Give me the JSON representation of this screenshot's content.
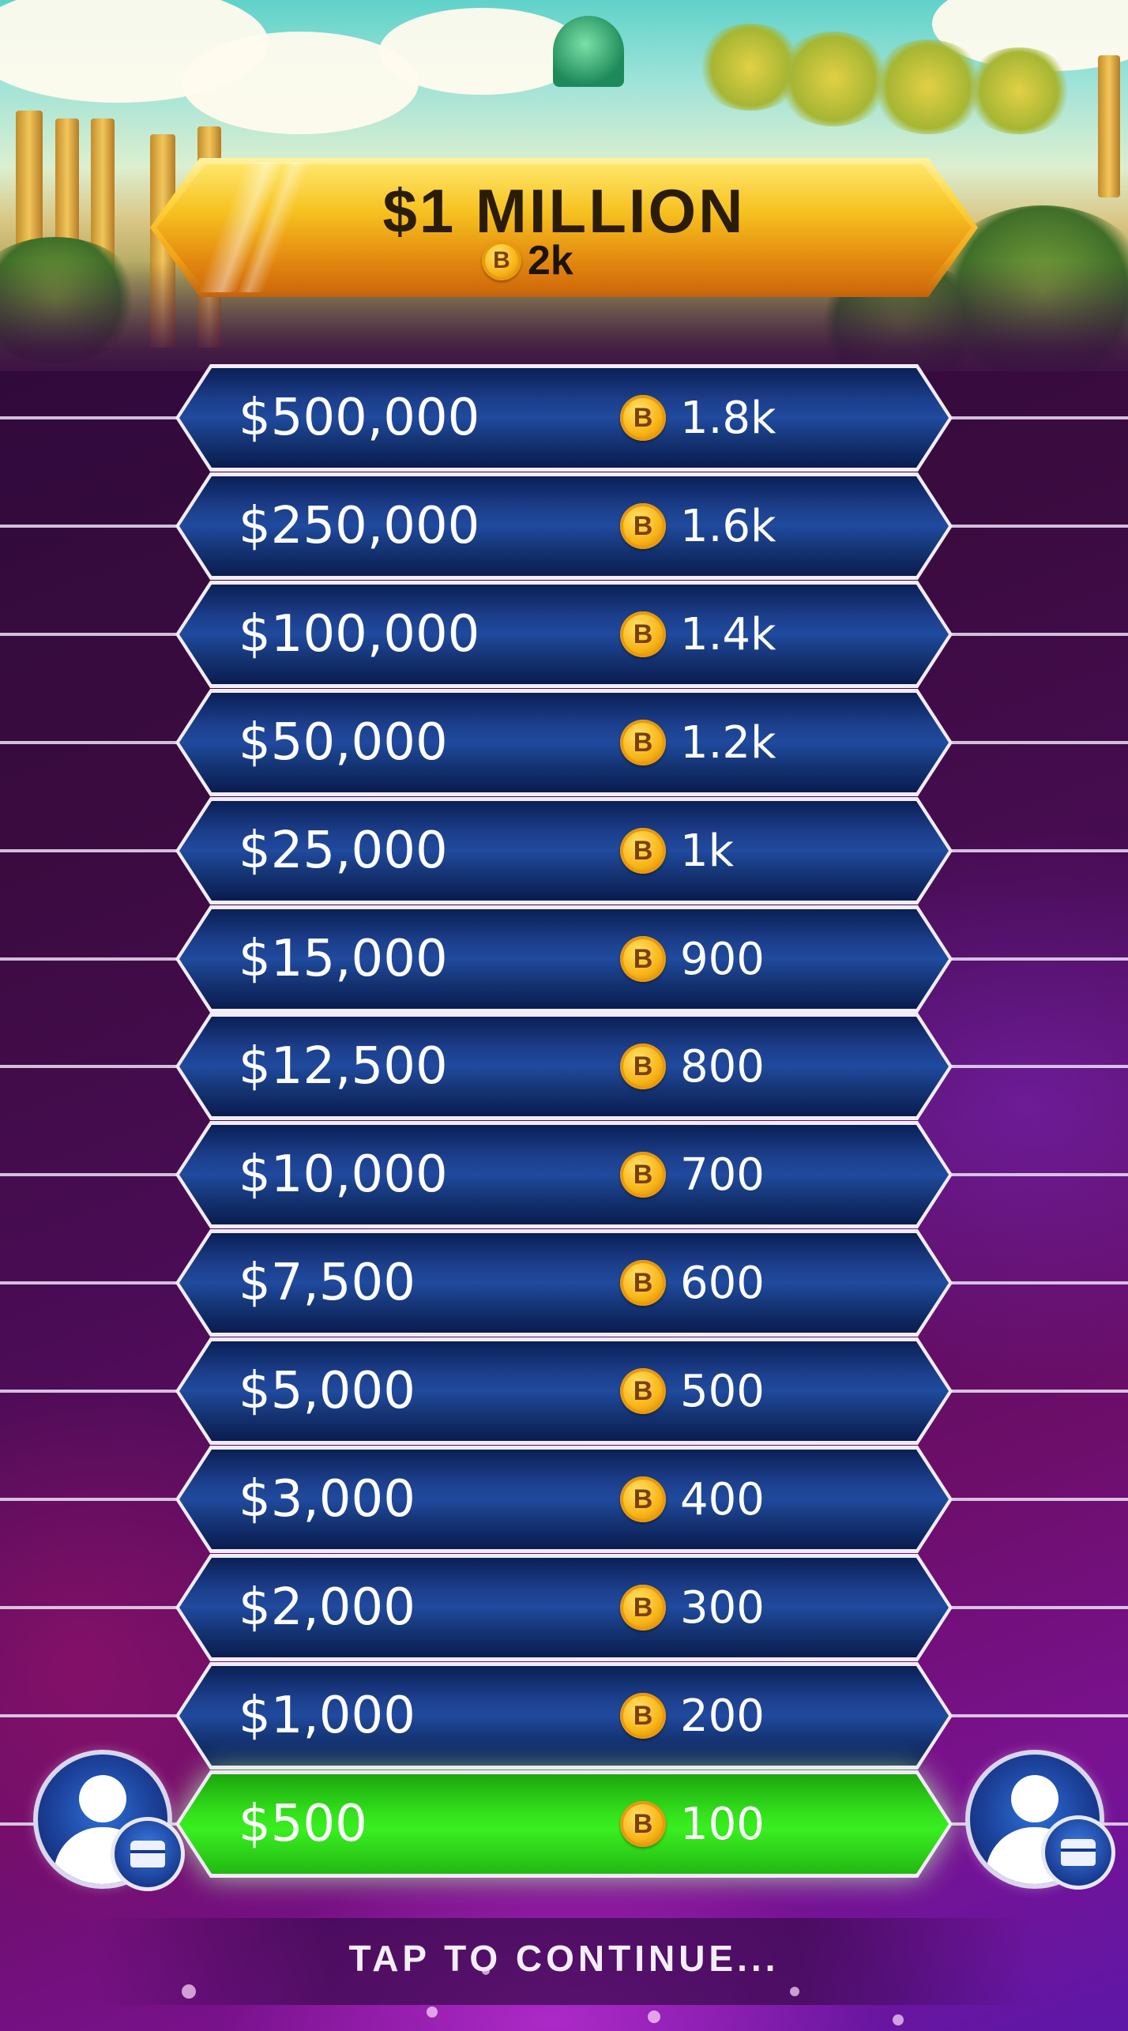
{
  "top_prize": {
    "title": "$1 MILLION",
    "coin_label": "2k"
  },
  "coin_symbol": "B",
  "ladder": [
    {
      "amount": "$500,000",
      "coins": "1.8k",
      "active": false
    },
    {
      "amount": "$250,000",
      "coins": "1.6k",
      "active": false
    },
    {
      "amount": "$100,000",
      "coins": "1.4k",
      "active": false
    },
    {
      "amount": "$50,000",
      "coins": "1.2k",
      "active": false
    },
    {
      "amount": "$25,000",
      "coins": "1k",
      "active": false
    },
    {
      "amount": "$15,000",
      "coins": "900",
      "active": false
    },
    {
      "amount": "$12,500",
      "coins": "800",
      "active": false
    },
    {
      "amount": "$10,000",
      "coins": "700",
      "active": false
    },
    {
      "amount": "$7,500",
      "coins": "600",
      "active": false
    },
    {
      "amount": "$5,000",
      "coins": "500",
      "active": false
    },
    {
      "amount": "$3,000",
      "coins": "400",
      "active": false
    },
    {
      "amount": "$2,000",
      "coins": "300",
      "active": false
    },
    {
      "amount": "$1,000",
      "coins": "200",
      "active": false
    },
    {
      "amount": "$500",
      "coins": "100",
      "active": true
    }
  ],
  "footer": {
    "continue_label": "TAP TO CONTINUE..."
  },
  "colors": {
    "rung_blue": "#1c3f8c",
    "rung_active_green": "#34e21c",
    "banner_gold": "#f6c11f",
    "background_purple": "#4a0c55"
  }
}
